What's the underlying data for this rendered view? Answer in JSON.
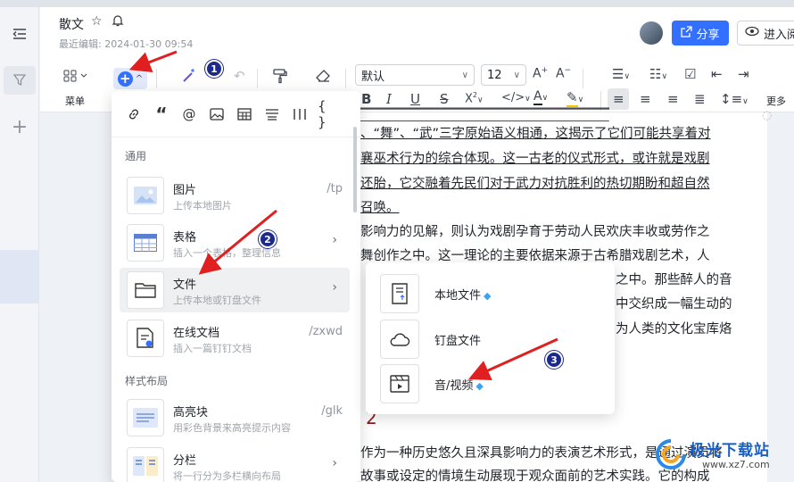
{
  "header": {
    "title": "散文",
    "meta": "最近编辑: 2024-01-30 09:54",
    "share_label": "分享",
    "enter_label": "进入阅读"
  },
  "toolbar": {
    "menu_label": "菜单",
    "font_family": "默认",
    "font_size": "12",
    "more_label": "更多"
  },
  "content": {
    "lines": [
      "、“舞”、“武”三字原始语义相通，这揭示了它们可能共享着对",
      "襄巫术行为的综合体现。这一古老的仪式形式，或许就是戏剧",
      "还胎，它交融着先民们对于武力对抗胜利的热切期盼和超自然",
      "召唤。",
      "影响力的见解，则认为戏剧孕育于劳动人民欢庆丰收或劳作之",
      "舞创作之中。这一理论的主要依据来源于古希腊戏剧艺术，人",
      "之中。那些醉人的音",
      "中交织成一幅生动的",
      "为人类的文化宝库烙"
    ],
    "heading": "2",
    "bottom_line": "作为一种历史悠久且深具影响力的表演艺术形式，是通过演员将",
    "bottom_line2": "故事或设定的情境生动展现于观众面前的艺术实践。它的构成"
  },
  "insert_menu": {
    "section_general": "通用",
    "section_layout": "样式布局",
    "items": [
      {
        "title": "图片",
        "sub": "上传本地图片",
        "shortcut": "/tp"
      },
      {
        "title": "表格",
        "sub": "插入一个表格，整理信息",
        "shortcut": ""
      },
      {
        "title": "文件",
        "sub": "上传本地或钉盘文件",
        "shortcut": ""
      },
      {
        "title": "在线文档",
        "sub": "插入一篇钉钉文档",
        "shortcut": "/zxwd"
      },
      {
        "title": "高亮块",
        "sub": "用彩色背景来高亮提示内容",
        "shortcut": "/glk"
      },
      {
        "title": "分栏",
        "sub": "将一行分为多栏横向布局",
        "shortcut": ""
      }
    ]
  },
  "file_submenu": {
    "items": [
      {
        "title": "本地文件"
      },
      {
        "title": "钉盘文件"
      },
      {
        "title": "音/视频"
      }
    ]
  },
  "badges": [
    "1",
    "2",
    "3"
  ],
  "watermark": {
    "text": "极光下载站",
    "url": "www.xz7.com"
  },
  "colors": {
    "accent": "#3370ff",
    "arrow": "#e02020",
    "badge": "#1c2a8c",
    "heading": "#8b1d1d"
  }
}
